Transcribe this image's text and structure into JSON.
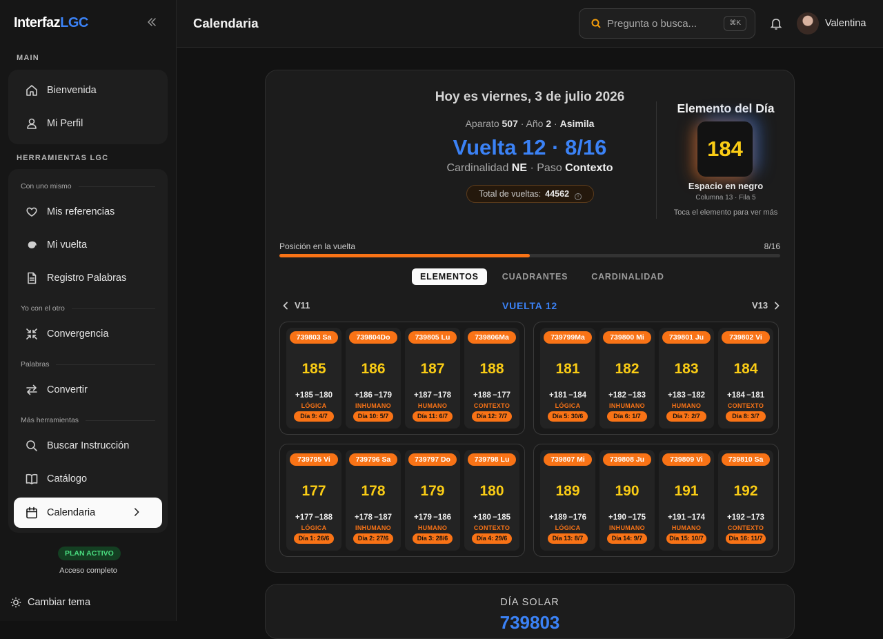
{
  "sidebar": {
    "logo_a": "Interfaz",
    "logo_b": "LGC",
    "section_main": "MAIN",
    "section_tools": "HERRAMIENTAS LGC",
    "main_items": [
      {
        "label": "Bienvenida",
        "icon": "home-icon"
      },
      {
        "label": "Mi Perfil",
        "icon": "user-icon"
      }
    ],
    "sub1": "Con uno mismo",
    "sub2": "Yo con el otro",
    "sub3": "Palabras",
    "sub4": "Más herramientas",
    "tools": [
      {
        "label": "Mis referencias",
        "icon": "heart-icon"
      },
      {
        "label": "Mi vuelta",
        "icon": "spiral-icon"
      },
      {
        "label": "Registro Palabras",
        "icon": "document-icon"
      },
      {
        "label": "Convergencia",
        "icon": "converge-icon"
      },
      {
        "label": "Convertir",
        "icon": "swap-arrows-icon"
      },
      {
        "label": "Buscar Instrucción",
        "icon": "search-icon"
      },
      {
        "label": "Catálogo",
        "icon": "book-icon"
      },
      {
        "label": "Calendaria",
        "icon": "calendar-icon"
      }
    ],
    "plan_badge": "PLAN ACTIVO",
    "plan_desc": "Acceso completo",
    "theme_label": "Cambiar tema",
    "accent": "#3b82f6"
  },
  "header": {
    "title": "Calendaria",
    "search_placeholder": "Pregunta o busca...",
    "shortcut": "⌘K",
    "user_name": "Valentina"
  },
  "summary": {
    "today": "Hoy es viernes, 3 de julio 2026",
    "aparato_label": "Aparato",
    "aparato": "507",
    "anio_label": "Año",
    "anio": "2",
    "fase": "Asimila",
    "vuelta": "Vuelta 12 · 8/16",
    "cardinalidad_label": "Cardinalidad",
    "cardinalidad": "NE",
    "paso_label": "Paso",
    "paso": "Contexto",
    "total_label": "Total de vueltas:",
    "total_value": "44562",
    "element_title": "Elemento del Día",
    "element_number": "184",
    "element_name": "Espacio en negro",
    "element_pos": "Columna 13 · Fila 5",
    "element_hint": "Toca el elemento para ver más",
    "progress_label": "Posición en la vuelta",
    "progress_text": "8/16",
    "progress_fraction": 0.5,
    "progress_color": "#f97316"
  },
  "tabs": [
    "ELEMENTOS",
    "CUADRANTES",
    "CARDINALIDAD"
  ],
  "vnav": {
    "prev": "V11",
    "title": "VUELTA 12",
    "next": "V13"
  },
  "quadrants": [
    [
      {
        "code": "739803 Sa",
        "num": "185",
        "pm": "+185 −180",
        "kw": "LÓGICA",
        "day": "Día 9: 4/7"
      },
      {
        "code": "739804Do",
        "num": "186",
        "pm": "+186 −179",
        "kw": "INHUMANO",
        "day": "Día 10: 5/7"
      },
      {
        "code": "739805 Lu",
        "num": "187",
        "pm": "+187 −178",
        "kw": "HUMANO",
        "day": "Día 11: 6/7"
      },
      {
        "code": "739806Ma",
        "num": "188",
        "pm": "+188 −177",
        "kw": "CONTEXTO",
        "day": "Día 12: 7/7"
      }
    ],
    [
      {
        "code": "739799Ma",
        "num": "181",
        "pm": "+181 −184",
        "kw": "LÓGICA",
        "day": "Día 5: 30/6"
      },
      {
        "code": "739800 Mi",
        "num": "182",
        "pm": "+182 −183",
        "kw": "INHUMANO",
        "day": "Día 6: 1/7"
      },
      {
        "code": "739801 Ju",
        "num": "183",
        "pm": "+183 −182",
        "kw": "HUMANO",
        "day": "Día 7: 2/7"
      },
      {
        "code": "739802 Vi",
        "num": "184",
        "pm": "+184 −181",
        "kw": "CONTEXTO",
        "day": "Día 8: 3/7"
      }
    ],
    [
      {
        "code": "739795 Vi",
        "num": "177",
        "pm": "+177 −188",
        "kw": "LÓGICA",
        "day": "Día 1: 26/6"
      },
      {
        "code": "739796 Sa",
        "num": "178",
        "pm": "+178 −187",
        "kw": "INHUMANO",
        "day": "Día 2: 27/6"
      },
      {
        "code": "739797 Do",
        "num": "179",
        "pm": "+179 −186",
        "kw": "HUMANO",
        "day": "Día 3: 28/6"
      },
      {
        "code": "739798 Lu",
        "num": "180",
        "pm": "+180 −185",
        "kw": "CONTEXTO",
        "day": "Día 4: 29/6"
      }
    ],
    [
      {
        "code": "739807 Mi",
        "num": "189",
        "pm": "+189 −176",
        "kw": "LÓGICA",
        "day": "Día 13: 8/7"
      },
      {
        "code": "739808 Ju",
        "num": "190",
        "pm": "+190 −175",
        "kw": "INHUMANO",
        "day": "Día 14: 9/7"
      },
      {
        "code": "739809 Vi",
        "num": "191",
        "pm": "+191 −174",
        "kw": "HUMANO",
        "day": "Día 15: 10/7"
      },
      {
        "code": "739810 Sa",
        "num": "192",
        "pm": "+192 −173",
        "kw": "CONTEXTO",
        "day": "Día 16: 11/7"
      }
    ]
  ],
  "solar": {
    "label": "DÍA SOLAR",
    "value": "739803"
  }
}
